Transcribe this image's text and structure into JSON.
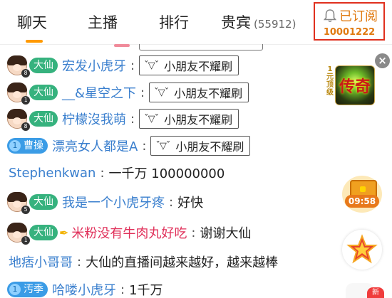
{
  "tabs": [
    {
      "label": "聊天",
      "active": true
    },
    {
      "label": "主播"
    },
    {
      "label": "排行"
    },
    {
      "label": "贵宾",
      "count": "(55912)"
    }
  ],
  "subscribe": {
    "label": "已订阅",
    "count": "10001222",
    "icon": "bell-icon"
  },
  "messages": [
    {
      "badge": "大仙",
      "level": "8",
      "user": "宏发小虎牙",
      "emote_text": "小朋友不耀刷",
      "emote_face": "ˇ▽ˇ"
    },
    {
      "badge": "大仙",
      "level": "1",
      "user": "__&星空之下",
      "emote_text": "小朋友不耀刷",
      "emote_face": "ˇ▽ˇ"
    },
    {
      "badge": "大仙",
      "level": "8",
      "user": "柠檬沒我萌",
      "emote_text": "小朋友不耀刷",
      "emote_face": "ˇ▽ˇ"
    },
    {
      "badge": "曹操",
      "badge_level": "1",
      "user": "漂亮女人都是A",
      "emote_text": "小朋友不耀刷",
      "emote_face": "ˇ▽ˇ"
    },
    {
      "user": "Stephenkwan",
      "text": "一千万 100000000"
    },
    {
      "badge": "大仙",
      "level": "5",
      "user": "我是一个小虎牙疼",
      "text": "好快"
    },
    {
      "badge": "大仙",
      "level": "1",
      "user": "米粉没有牛肉丸好吃",
      "text": "谢谢大仙",
      "has_pen": true
    },
    {
      "user": "地痞小哥哥",
      "text": "大仙的直播间越来越好，越来越棒"
    },
    {
      "badge": "汚季",
      "badge_level": "1",
      "user": "哈喽小虎牙",
      "text": "1千万"
    }
  ],
  "colon": ":",
  "ad": {
    "glyph": "传奇",
    "side_text": "1元顶级",
    "close": "×"
  },
  "chest": {
    "timer": "09:58"
  },
  "new_badge": "新",
  "colors": {
    "accent": "#ff9a00",
    "username": "#3a7fce",
    "badge_green": "#36b27e",
    "badge_blue": "#3b9ce6",
    "subscribe_border": "#e0301e"
  }
}
